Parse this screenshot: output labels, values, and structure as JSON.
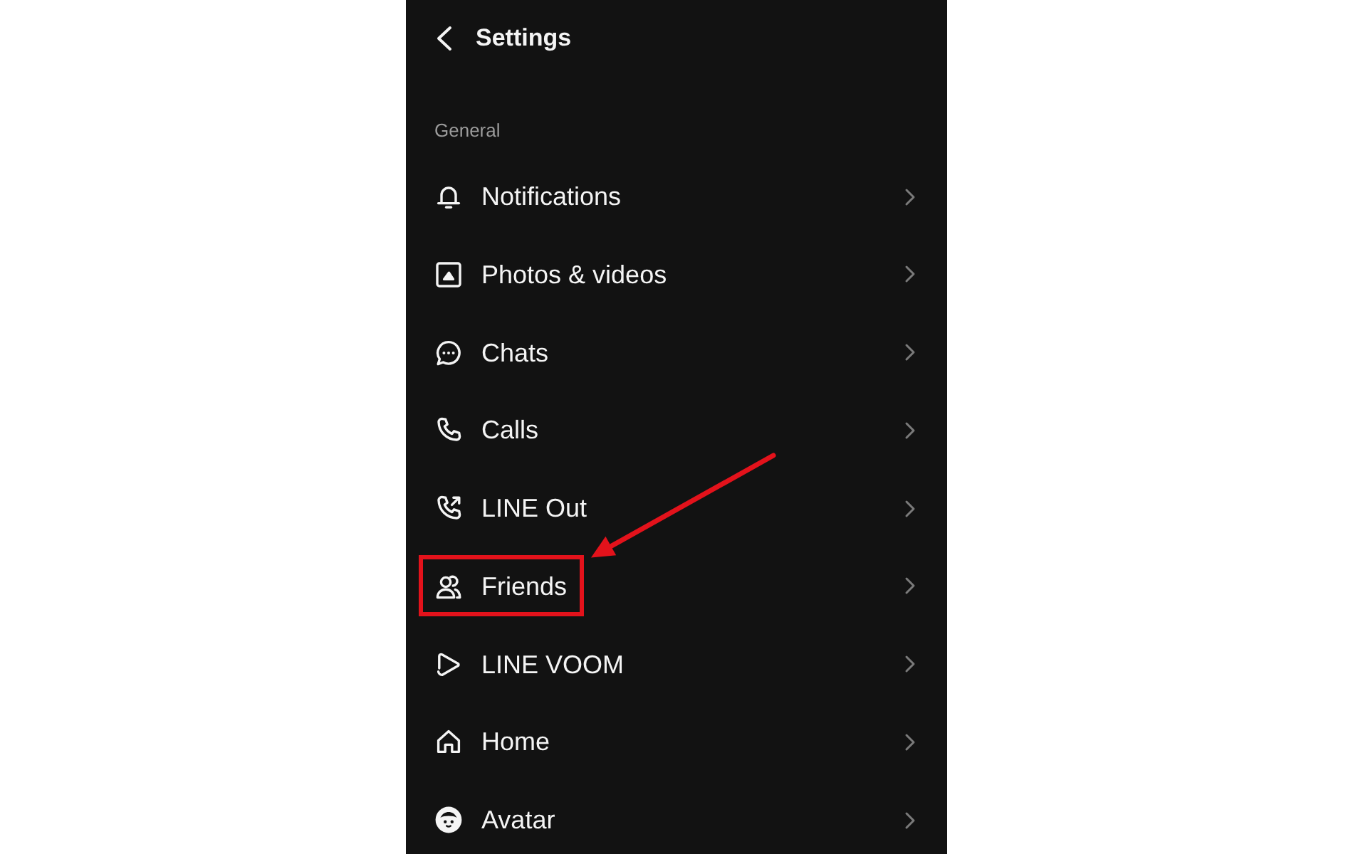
{
  "header": {
    "title": "Settings"
  },
  "section": {
    "label": "General"
  },
  "items": [
    {
      "kind": "notifications",
      "label": "Notifications",
      "highlighted": false
    },
    {
      "kind": "photos",
      "label": "Photos & videos",
      "highlighted": false
    },
    {
      "kind": "chats",
      "label": "Chats",
      "highlighted": false
    },
    {
      "kind": "calls",
      "label": "Calls",
      "highlighted": false
    },
    {
      "kind": "lineout",
      "label": "LINE Out",
      "highlighted": false
    },
    {
      "kind": "friends",
      "label": "Friends",
      "highlighted": true
    },
    {
      "kind": "voom",
      "label": "LINE VOOM",
      "highlighted": false
    },
    {
      "kind": "home",
      "label": "Home",
      "highlighted": false
    },
    {
      "kind": "avatar",
      "label": "Avatar",
      "highlighted": false
    }
  ]
}
